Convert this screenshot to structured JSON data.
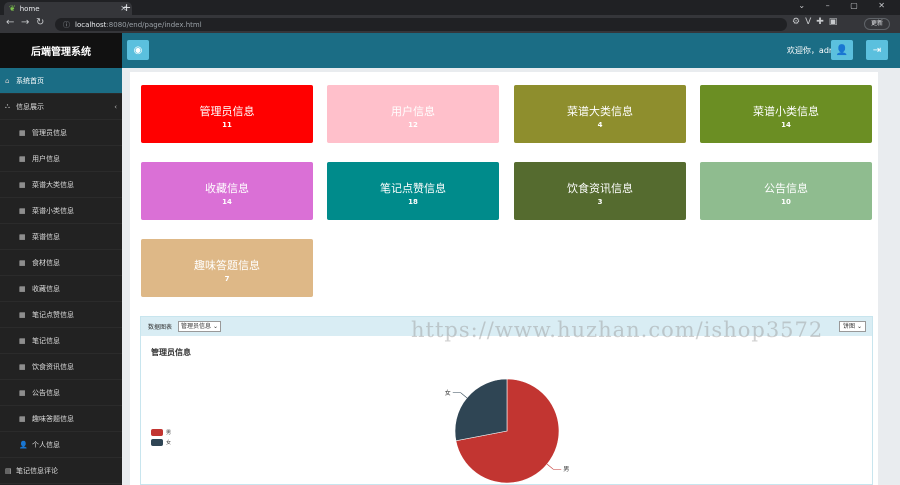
{
  "browser": {
    "tab_title": "home",
    "url_host": "localhost",
    "url_path": ":8080/end/page/index.html",
    "update_label": "更新"
  },
  "sidebar": {
    "brand": "后端管理系统",
    "items": [
      {
        "label": "系统首页",
        "icon": "home-icon",
        "active": true
      },
      {
        "label": "信息展示",
        "icon": "sitemap-icon",
        "expandable": true
      },
      {
        "label": "管理员信息",
        "icon": "table-icon",
        "sub": true
      },
      {
        "label": "用户信息",
        "icon": "table-icon",
        "sub": true
      },
      {
        "label": "菜谱大类信息",
        "icon": "table-icon",
        "sub": true
      },
      {
        "label": "菜谱小类信息",
        "icon": "table-icon",
        "sub": true
      },
      {
        "label": "菜谱信息",
        "icon": "table-icon",
        "sub": true
      },
      {
        "label": "食材信息",
        "icon": "table-icon",
        "sub": true
      },
      {
        "label": "收藏信息",
        "icon": "table-icon",
        "sub": true
      },
      {
        "label": "笔记点赞信息",
        "icon": "table-icon",
        "sub": true
      },
      {
        "label": "笔记信息",
        "icon": "table-icon",
        "sub": true
      },
      {
        "label": "饮食资讯信息",
        "icon": "table-icon",
        "sub": true
      },
      {
        "label": "公告信息",
        "icon": "table-icon",
        "sub": true
      },
      {
        "label": "趣味答题信息",
        "icon": "table-icon",
        "sub": true
      },
      {
        "label": "个人信息",
        "icon": "user-icon",
        "sub": true
      },
      {
        "label": "笔记信息评论",
        "icon": "file-icon"
      }
    ]
  },
  "header": {
    "welcome": "欢迎你，admin"
  },
  "cards": [
    {
      "title": "管理员信息",
      "value": "11",
      "color": "#ff0000"
    },
    {
      "title": "用户信息",
      "value": "12",
      "color": "#ffc0cb"
    },
    {
      "title": "菜谱大类信息",
      "value": "4",
      "color": "#8e8e2d"
    },
    {
      "title": "菜谱小类信息",
      "value": "14",
      "color": "#6b8e23"
    },
    {
      "title": "收藏信息",
      "value": "14",
      "color": "#da70d6"
    },
    {
      "title": "笔记点赞信息",
      "value": "18",
      "color": "#008b8b"
    },
    {
      "title": "饮食资讯信息",
      "value": "3",
      "color": "#556b2f"
    },
    {
      "title": "公告信息",
      "value": "10",
      "color": "#8fbc8f"
    },
    {
      "title": "趣味答题信息",
      "value": "7",
      "color": "#deb887"
    }
  ],
  "chart_panel": {
    "label": "数据图表",
    "select_value": "管理员信息",
    "right_select_value": "饼图"
  },
  "chart_data": {
    "type": "pie",
    "title": "管理员信息",
    "categories": [
      "男",
      "女"
    ],
    "values": [
      72,
      28
    ],
    "colors": [
      "#c23531",
      "#2f4554"
    ],
    "legend": [
      "男",
      "女"
    ],
    "legend_position": "left-middle"
  },
  "watermark": "https://www.huzhan.com/ishop3572"
}
